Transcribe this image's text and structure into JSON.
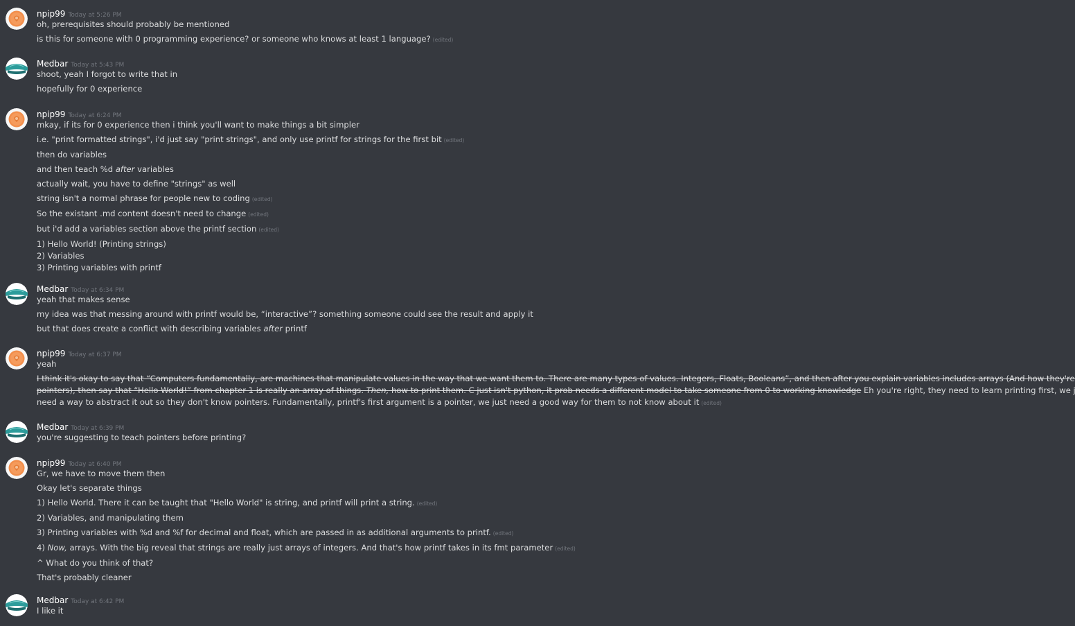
{
  "edited_label": "(edited)",
  "colors": {
    "background": "#36393f",
    "author": "#ffffff",
    "timestamp": "#72767d",
    "text": "#dcddde",
    "npip_avatar": "#f28e4b",
    "medbar_avatar": "#2c9c9b"
  },
  "groups": [
    {
      "author": "npip99",
      "timestamp": "Today at 5:26 PM",
      "avatar_icon": "npip99-avatar-icon",
      "messages": [
        {
          "text": "oh, prerequisites should probably be mentioned"
        },
        {
          "text": "is this for someone with 0 programming experience? or someone who knows at least 1 language?",
          "edited": true
        }
      ]
    },
    {
      "author": "Medbar",
      "timestamp": "Today at 5:43 PM",
      "avatar_icon": "medbar-avatar-icon",
      "messages": [
        {
          "text": "shoot, yeah I forgot to write that in"
        },
        {
          "text": "hopefully for 0 experience"
        }
      ]
    },
    {
      "author": "npip99",
      "timestamp": "Today at 6:24 PM",
      "avatar_icon": "npip99-avatar-icon",
      "messages": [
        {
          "text": "mkay, if its for 0 experience then i think you'll want to make things a bit simpler"
        },
        {
          "text": "i.e. \"print formatted strings\", i'd just say \"print strings\", and only use printf for strings for the first bit",
          "edited": true
        },
        {
          "text": "then do variables"
        },
        {
          "pre": "and then teach %d ",
          "em": "after",
          "post": " variables"
        },
        {
          "text": "actually wait, you have to define \"strings\" as well"
        },
        {
          "text": "string isn't a normal phrase for people new to coding",
          "edited": true
        },
        {
          "text": "So the existant .md content doesn't need to change",
          "edited": true
        },
        {
          "text": "but i'd add a variables section above the printf section",
          "edited": true
        },
        {
          "lines": [
            "1) Hello World! (Printing strings)",
            "2) Variables",
            "3) Printing variables with printf"
          ]
        }
      ]
    },
    {
      "author": "Medbar",
      "timestamp": "Today at 6:34 PM",
      "avatar_icon": "medbar-avatar-icon",
      "messages": [
        {
          "text": "yeah that makes sense"
        },
        {
          "text": "my idea was that messing around with printf would be, “interactive”? something someone could see the result and apply it"
        },
        {
          "pre": "but that does create a conflict with describing variables ",
          "em": "after",
          "post": " printf"
        }
      ]
    },
    {
      "author": "npip99",
      "timestamp": "Today at 6:37 PM",
      "avatar_icon": "npip99-avatar-icon",
      "messages": [
        {
          "text": "yeah"
        },
        {
          "strike_pre": "I think it's okay to say that “Computers fundamentally, are machines that manipulate values in the way that we want them to. There are many types of values. Integers, Floats, Booleans”, and then after you explain variables includes arrays (And how they're pointers), then say that “Hello World!” from chapter 1 is really an array of things. ",
          "strike_em": "Then,",
          "strike_post": " how to print them. C just isn't python, it prob needs a different model to take someone from 0 to working knowledge",
          "post": " Eh you're right, they need to learn printing first, we just need a way to abstract it out so they don't know pointers. Fundamentally, printf's first argument is a pointer, we just need a good way for them to not know about it",
          "edited": true
        }
      ]
    },
    {
      "author": "Medbar",
      "timestamp": "Today at 6:39 PM",
      "avatar_icon": "medbar-avatar-icon",
      "messages": [
        {
          "text": "you're suggesting to teach pointers before printing?"
        }
      ]
    },
    {
      "author": "npip99",
      "timestamp": "Today at 6:40 PM",
      "avatar_icon": "npip99-avatar-icon",
      "messages": [
        {
          "text": "Gr, we have to move them then"
        },
        {
          "text": "Okay let's separate things"
        },
        {
          "text": "1) Hello World. There it can be taught that \"Hello World\" is string, and printf will print a string.",
          "edited": true
        },
        {
          "text": "2) Variables, and manipulating them"
        },
        {
          "text": "3) Printing variables with %d and %f for decimal and float, which are passed in as additional arguments to printf.",
          "edited": true
        },
        {
          "pre": "4) ",
          "em": "Now,",
          "post": " arrays. With the big reveal that strings are really just arrays of integers. And that's how printf takes in its fmt parameter",
          "edited": true
        },
        {
          "text": "^ What do you think of that?"
        },
        {
          "text": "That's probably cleaner"
        }
      ]
    },
    {
      "author": "Medbar",
      "timestamp": "Today at 6:42 PM",
      "avatar_icon": "medbar-avatar-icon",
      "messages": [
        {
          "text": "I like it"
        }
      ]
    }
  ]
}
